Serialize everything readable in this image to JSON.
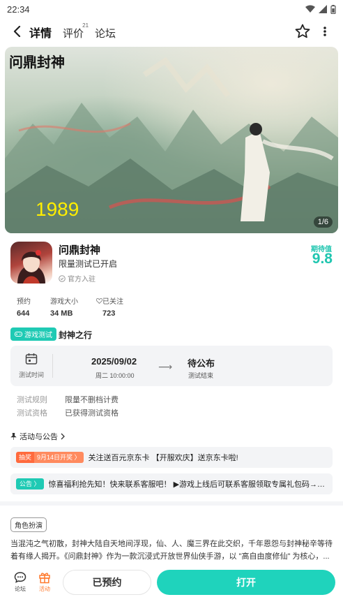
{
  "status_bar": {
    "time": "22:34"
  },
  "nav": {
    "tabs": [
      {
        "label": "详情",
        "sup": ""
      },
      {
        "label": "评价",
        "sup": "21"
      },
      {
        "label": "论坛",
        "sup": ""
      }
    ]
  },
  "banner": {
    "logo_text": "问鼎封神",
    "year_text": "1989",
    "counter": "1/6"
  },
  "game": {
    "title": "问鼎封神",
    "subtitle": "限量测试已开启",
    "official": "官方入驻",
    "expect_label": "期待值",
    "expect_score": "9.8",
    "stats": [
      {
        "label": "预约",
        "value": "644"
      },
      {
        "label": "游戏大小",
        "value": "34 MB"
      },
      {
        "label": "已关注",
        "value": "723"
      }
    ]
  },
  "test": {
    "tag": "游戏测试",
    "name": "封神之行",
    "calendar_label": "测试时间",
    "start_date": "2025/09/02",
    "start_time": "周二 10:00:00",
    "arrow": "⟶",
    "end_text": "待公布",
    "end_sub": "测试结束",
    "rules": [
      {
        "k": "测试规则",
        "v": "限量不删档计费"
      },
      {
        "k": "测试资格",
        "v": "已获得测试资格"
      }
    ]
  },
  "events": {
    "title": "活动与公告",
    "items": [
      {
        "badge_a": "抽奖",
        "badge_b": "9月14日开奖 〉",
        "text": "关注送百元京东卡 【开服欢庆】送京东卡啦!"
      },
      {
        "badge": "公告 〉",
        "text": "惊喜福利抢先知！快来联系客服吧！ ▶游戏上线后可联系客服领取专属礼包码→礼..."
      }
    ]
  },
  "genre_tag": "角色扮演",
  "description": "当混沌之气初散，封神大陆自天地间浮现，仙、人、魔三界在此交织，千年恩怨与封神秘辛等待着有缘人揭开。《问鼎封神》作为一款沉浸式开放世界仙侠手游，以 \"高自由度修仙\" 为核心，...",
  "bottom_bar": {
    "forum_label": "论坛",
    "activity_label": "活动",
    "reserved_label": "已预约",
    "open_label": "打开"
  },
  "colors": {
    "accent": "#1fd3bc",
    "lottery": "#ff6a3d",
    "activity": "#ff7a2e"
  }
}
